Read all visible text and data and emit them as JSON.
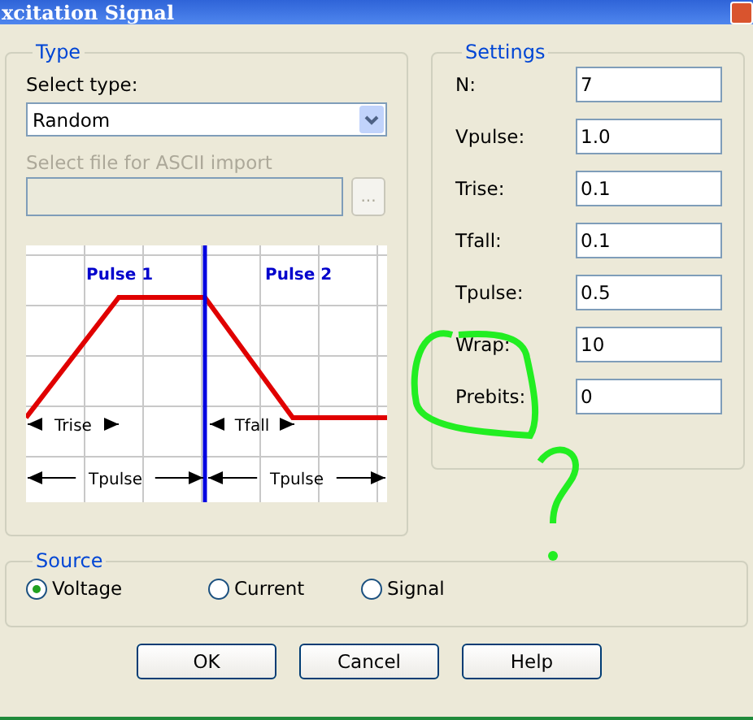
{
  "window": {
    "title": "xcitation Signal"
  },
  "type_group": {
    "title": "Type",
    "select_label": "Select type:",
    "select_value": "Random",
    "file_label": "Select file for ASCII import",
    "file_disabled": true,
    "browse_label": "...",
    "diagram": {
      "pulse_labels": [
        "Pulse 1",
        "Pulse 2"
      ],
      "spans": [
        {
          "label": "Trise"
        },
        {
          "label": "Tfall"
        },
        {
          "label": "Tpulse"
        },
        {
          "label": "Tpulse"
        }
      ]
    }
  },
  "settings": {
    "title": "Settings",
    "fields": [
      {
        "label": "N:",
        "value": "7"
      },
      {
        "label": "Vpulse:",
        "value": "1.0"
      },
      {
        "label": "Trise:",
        "value": "0.1"
      },
      {
        "label": "Tfall:",
        "value": "0.1"
      },
      {
        "label": "Tpulse:",
        "value": "0.5"
      },
      {
        "label": "Wrap:",
        "value": "10"
      },
      {
        "label": "Prebits:",
        "value": "0"
      }
    ]
  },
  "source": {
    "title": "Source",
    "options": [
      {
        "label": "Voltage",
        "selected": true
      },
      {
        "label": "Current",
        "selected": false
      },
      {
        "label": "Signal",
        "selected": false
      }
    ]
  },
  "buttons": [
    {
      "label": "OK"
    },
    {
      "label": "Cancel"
    },
    {
      "label": "Help"
    }
  ]
}
